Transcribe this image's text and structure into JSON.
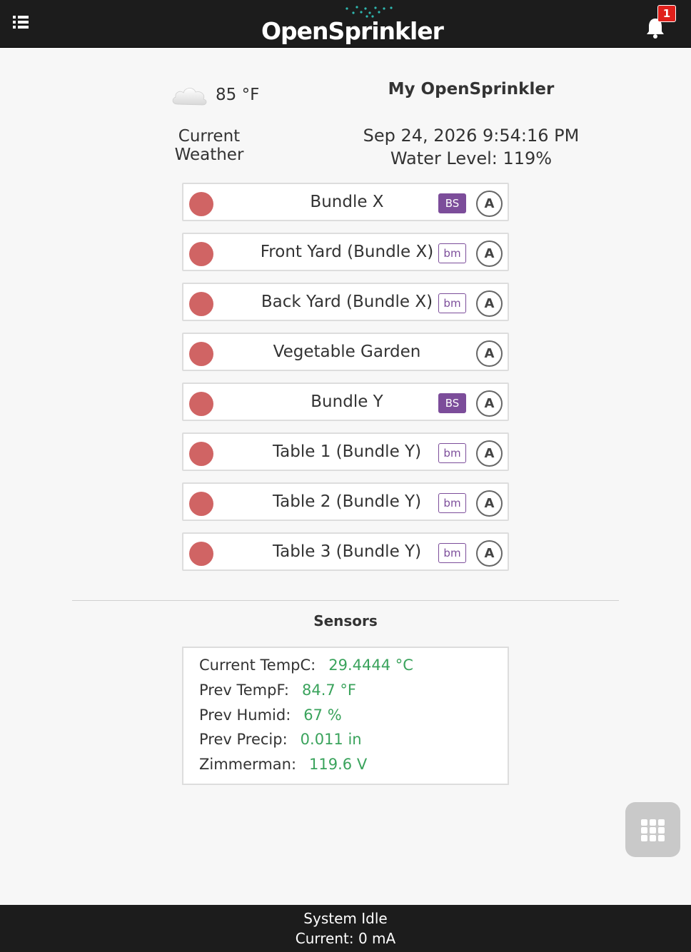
{
  "header": {
    "logo_text": "OpenSprinkler",
    "notification_count": "1"
  },
  "weather": {
    "temperature": "85 °F",
    "label": "Current Weather",
    "icon": "cloud-icon"
  },
  "device": {
    "name": "My OpenSprinkler",
    "datetime": "Sep 24, 2026 9:54:16 PM",
    "water_level": "Water Level: 119%"
  },
  "stations": [
    {
      "name": "Bundle X",
      "tag": "BS",
      "auto": "A"
    },
    {
      "name": "Front Yard (Bundle X)",
      "tag": "bm",
      "auto": "A"
    },
    {
      "name": "Back Yard (Bundle X)",
      "tag": "bm",
      "auto": "A"
    },
    {
      "name": "Vegetable Garden",
      "tag": "",
      "auto": "A"
    },
    {
      "name": "Bundle Y",
      "tag": "BS",
      "auto": "A"
    },
    {
      "name": "Table 1 (Bundle Y)",
      "tag": "bm",
      "auto": "A"
    },
    {
      "name": "Table 2 (Bundle Y)",
      "tag": "bm",
      "auto": "A"
    },
    {
      "name": "Table 3 (Bundle Y)",
      "tag": "bm",
      "auto": "A"
    }
  ],
  "sensors": {
    "title": "Sensors",
    "items": [
      {
        "label": "Current TempC:",
        "value": "29.4444 °C"
      },
      {
        "label": "Prev TempF:",
        "value": "84.7 °F"
      },
      {
        "label": "Prev Humid:",
        "value": "67 %"
      },
      {
        "label": "Prev Precip:",
        "value": "0.011 in"
      },
      {
        "label": "Zimmerman:",
        "value": "119.6 V"
      }
    ]
  },
  "footer": {
    "status": "System Idle",
    "current": "Current: 0 mA"
  },
  "colors": {
    "header_bg": "#1c1c1c",
    "station_off": "#d06464",
    "bundle_tag": "#7c4d9a",
    "sensor_value": "#3aa35c",
    "badge": "#e0201b"
  }
}
